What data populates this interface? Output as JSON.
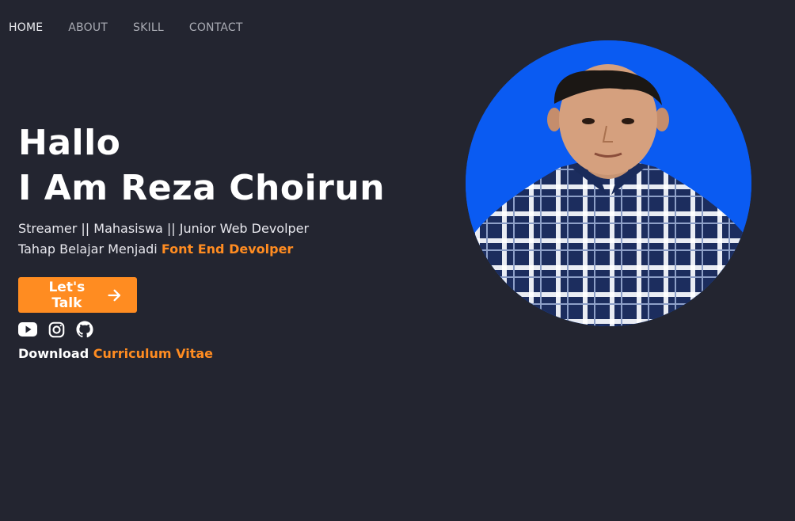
{
  "nav": {
    "items": [
      {
        "label": "HOME",
        "active": true
      },
      {
        "label": "ABOUT",
        "active": false
      },
      {
        "label": "SKILL",
        "active": false
      },
      {
        "label": "CONTACT",
        "active": false
      }
    ]
  },
  "hero": {
    "greeting": "Hallo",
    "name_line": "I Am Reza Choirun",
    "tagline": "Streamer || Mahasiswa || Junior Web Devolper",
    "learning_prefix": "Tahap Belajar Menjadi",
    "learning_accent": "Font End Devolper",
    "cta_label": "Let's Talk",
    "download_prefix": "Download",
    "download_link": "Curriculum Vitae"
  },
  "socials": [
    {
      "icon": "youtube-icon"
    },
    {
      "icon": "instagram-icon"
    },
    {
      "icon": "github-icon"
    }
  ],
  "colors": {
    "background": "#232530",
    "accent": "#ff8c21",
    "photo_background": "#0a5bf2"
  }
}
